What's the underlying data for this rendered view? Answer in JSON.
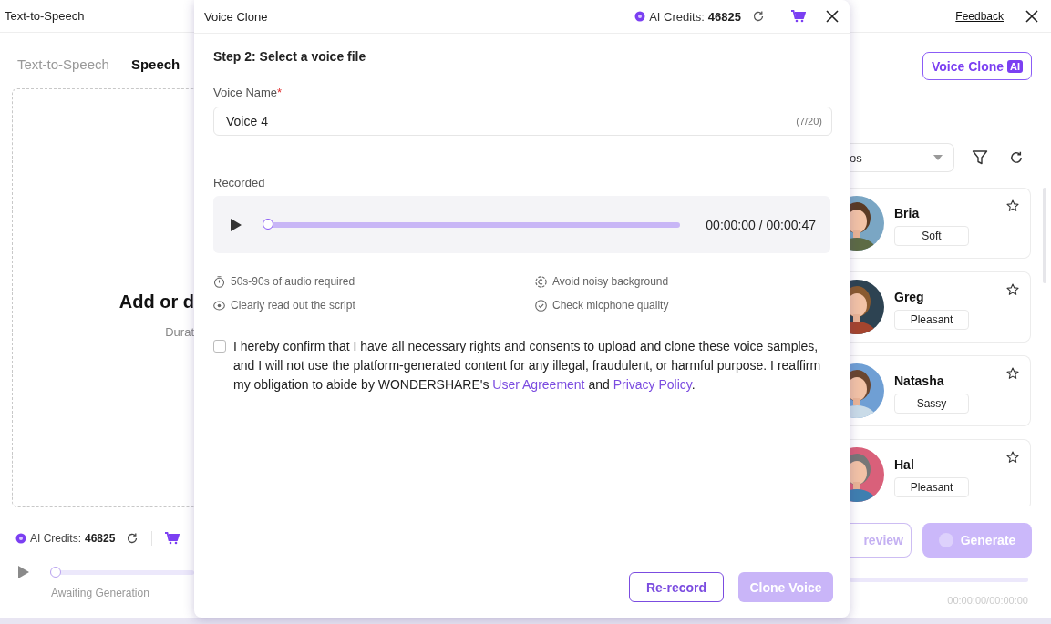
{
  "app": {
    "title": "Text-to-Speech",
    "feedback": "Feedback",
    "tabs": [
      {
        "label": "Text-to-Speech",
        "selected": false
      },
      {
        "label": "Speech",
        "selected": true
      }
    ],
    "upload": {
      "heading": "Add or d",
      "hint": "Durat"
    },
    "credits": {
      "label": "AI Credits:",
      "value": "46825"
    },
    "player": {
      "level": 0,
      "status": "Awaiting Generation",
      "time": "00:00:00/00:00:00"
    },
    "voice_clone_button": {
      "label": "Voice Clone",
      "badge": "AI"
    },
    "filter": {
      "value": "os"
    },
    "voices": [
      {
        "name": "Bria",
        "tag": "Soft"
      },
      {
        "name": "Greg",
        "tag": "Pleasant"
      },
      {
        "name": "Natasha",
        "tag": "Sassy"
      },
      {
        "name": "Hal",
        "tag": "Pleasant"
      }
    ],
    "buttons": [
      {
        "kind": "outline",
        "label": "review",
        "disabled": true
      },
      {
        "kind": "filled",
        "label": "Generate",
        "disabled": true
      }
    ]
  },
  "dialog": {
    "title": "Voice Clone",
    "credits": {
      "label": "AI Credits:",
      "value": "46825"
    },
    "step": "Step 2: Select a voice file",
    "name_field": {
      "label": "Voice Name",
      "required_mark": "*",
      "value": "Voice 4",
      "counter": "(7/20)"
    },
    "recorded_label": "Recorded",
    "recording": {
      "level": 0,
      "time": "00:00:00 / 00:00:47"
    },
    "tips": [
      {
        "kind": "timer",
        "text": "50s-90s of audio required"
      },
      {
        "kind": "noise",
        "text": "Avoid noisy background"
      },
      {
        "kind": "eye",
        "text": "Clearly read out the script"
      },
      {
        "kind": "check",
        "text": "Check micphone quality"
      }
    ],
    "consent": {
      "checked": false,
      "text": "I hereby confirm that I have all necessary rights and consents to upload and clone these voice samples, and I will not use the platform-generated content for any illegal, fraudulent, or harmful purpose. I reaffirm my obligation to abide by WONDERSHARE's",
      "links": [
        "User Agreement",
        "Privacy Policy"
      ],
      "joiner": "and",
      "end": "."
    },
    "buttons": [
      {
        "kind": "outline",
        "label": "Re-record",
        "disabled": false
      },
      {
        "kind": "filled",
        "label": "Clone Voice",
        "disabled": true
      }
    ]
  }
}
